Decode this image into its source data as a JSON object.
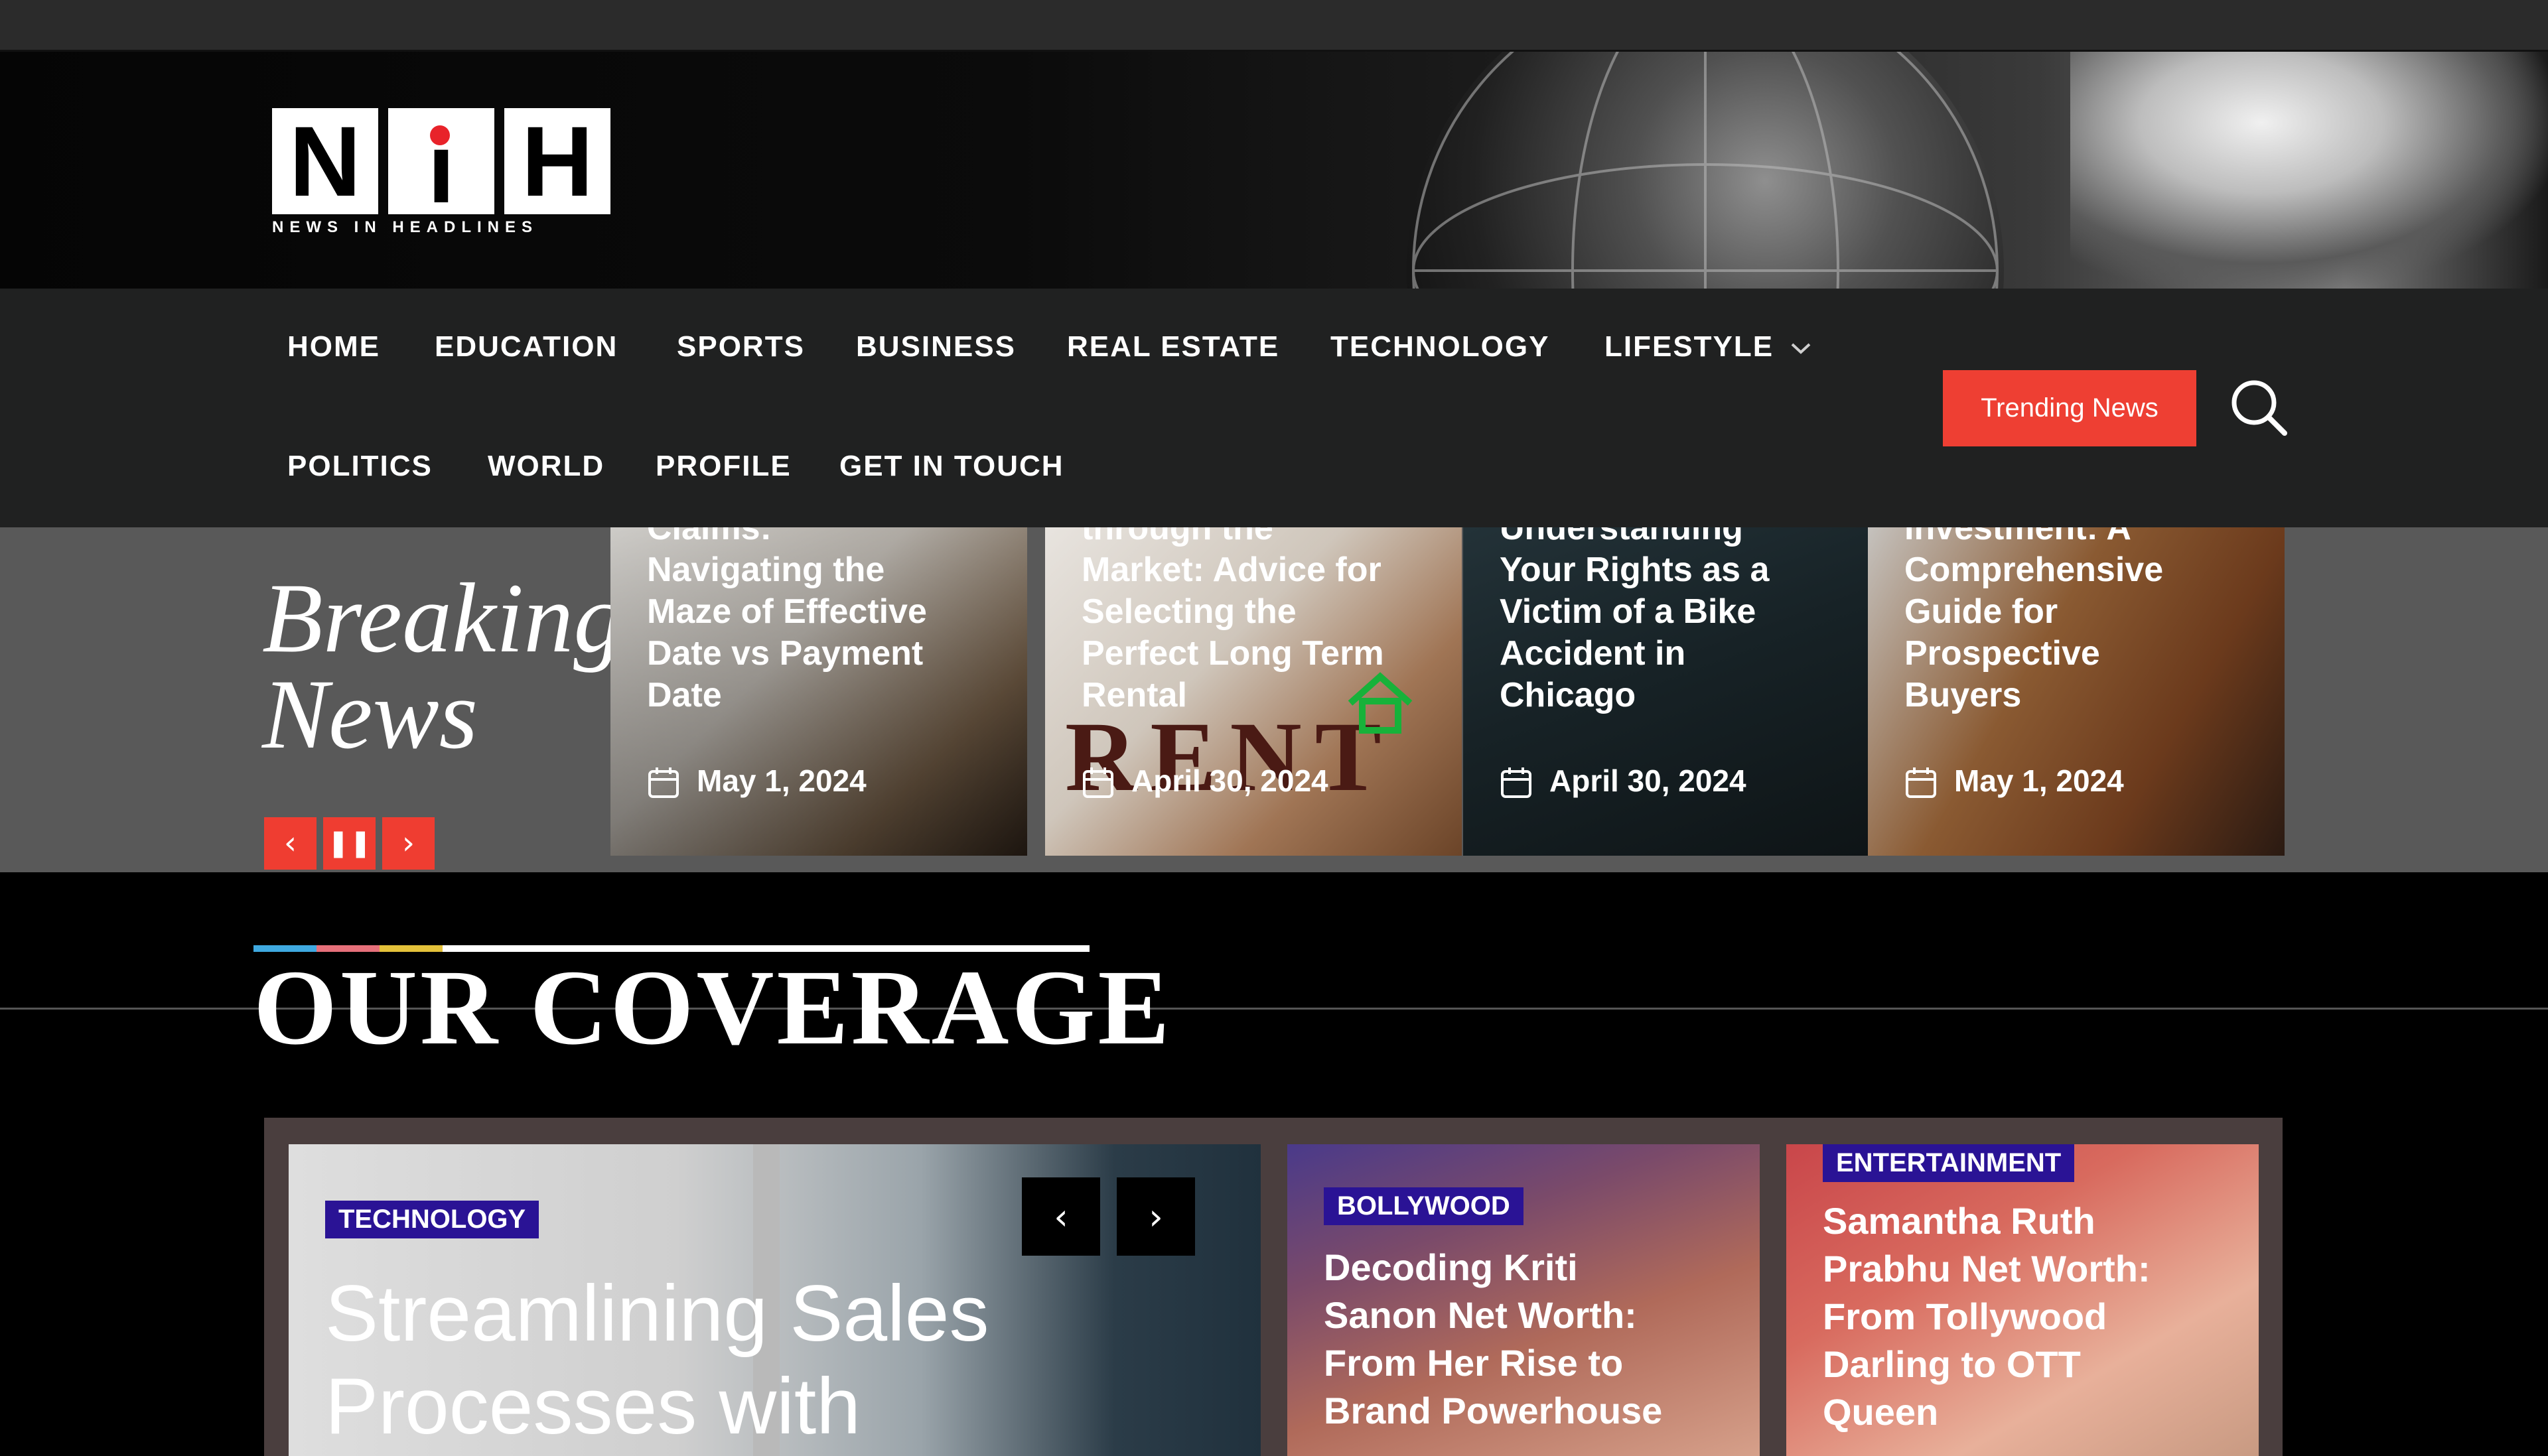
{
  "logo": {
    "letters": [
      "N",
      "i",
      "H"
    ],
    "subtitle": "NEWS IN HEADLINES",
    "dot_color": "#e8232a"
  },
  "nav": {
    "row1": [
      "HOME",
      "EDUCATION",
      "SPORTS",
      "BUSINESS",
      "REAL ESTATE",
      "TECHNOLOGY",
      "LIFESTYLE"
    ],
    "row2": [
      "POLITICS",
      "WORLD",
      "PROFILE",
      "GET IN TOUCH"
    ],
    "dropdown_icon": "chevron-down-icon",
    "trending_label": "Trending News",
    "search_icon": "search-icon",
    "accent": "#ee3f33"
  },
  "breaking": {
    "title_line1": "Breaking",
    "title_line2": "News",
    "controls": {
      "prev": "‹",
      "pause": "❚❚",
      "next": "›"
    },
    "cards": [
      {
        "lines": [
          "Claims:",
          "Navigating the",
          "Maze of Effective",
          "Date vs Payment",
          "Date"
        ],
        "date": "May 1, 2024"
      },
      {
        "lines": [
          "through the",
          "Market: Advice for",
          "Selecting the",
          "Perfect Long Term",
          "Rental"
        ],
        "date": "April 30, 2024"
      },
      {
        "lines": [
          "Understanding",
          "Your Rights as a",
          "Victim of a Bike",
          "Accident in",
          "Chicago"
        ],
        "date": "April 30, 2024"
      },
      {
        "lines": [
          "Investment: A",
          "Comprehensive",
          "Guide for",
          "Prospective",
          "Buyers"
        ],
        "date": "May 1, 2024"
      }
    ],
    "rent_sign": "RENT"
  },
  "coverage": {
    "title": "OUR COVERAGE",
    "main": {
      "tag": "TECHNOLOGY",
      "title_lines": [
        "Streamlining Sales",
        "Processes with"
      ],
      "prev": "‹",
      "next": "›"
    },
    "side1": {
      "tag": "BOLLYWOOD",
      "title_lines": [
        "Decoding Kriti",
        "Sanon Net Worth:",
        "From Her Rise to",
        "Brand Powerhouse"
      ]
    },
    "side2": {
      "tag": "ENTERTAINMENT",
      "title_lines": [
        "Samantha Ruth",
        "Prabhu Net Worth:",
        "From Tollywood",
        "Darling to OTT",
        "Queen"
      ]
    },
    "tag_color": "#2a1395"
  }
}
